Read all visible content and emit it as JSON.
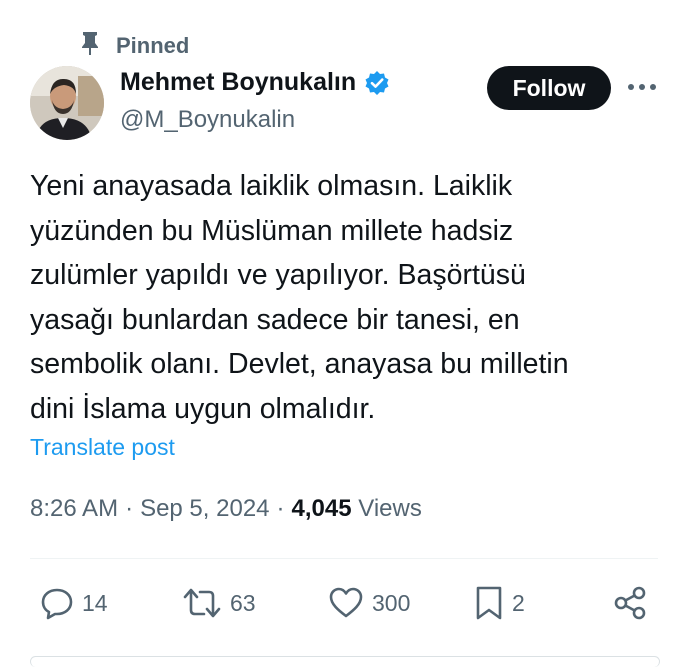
{
  "pinned_label": "Pinned",
  "author": {
    "name": "Mehmet Boynukalın",
    "handle": "@M_Boynukalin"
  },
  "follow_label": "Follow",
  "tweet_lines": [
    "Yeni anayasada laiklik olmasın. Laiklik",
    "yüzünden bu Müslüman millete hadsiz",
    "zulümler yapıldı ve yapılıyor. Başörtüsü",
    "yasağı bunlardan sadece bir tanesi, en",
    "sembolik olanı. Devlet, anayasa bu milletin",
    "dini İslama uygun olmalıdır."
  ],
  "translate_label": "Translate post",
  "meta": {
    "time": "8:26 AM",
    "separator": "·",
    "date": "Sep 5, 2024",
    "views_count": "4,045",
    "views_label": "Views"
  },
  "actions": {
    "replies": "14",
    "reposts": "63",
    "likes": "300",
    "bookmarks": "2"
  },
  "colors": {
    "text": "#0f1419",
    "muted": "#536471",
    "accent": "#1d9bf0",
    "follow_bg": "#0f1419"
  },
  "icons": [
    "pin-icon",
    "verified-badge-icon",
    "more-icon",
    "reply-icon",
    "repost-icon",
    "like-icon",
    "bookmark-icon",
    "share-icon"
  ]
}
